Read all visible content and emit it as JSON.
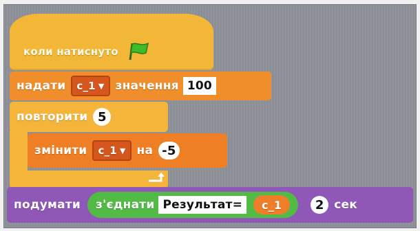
{
  "script": {
    "hat": {
      "label": "коли натиснуто",
      "icon": "green-flag-icon"
    },
    "set_var": {
      "label": "надати",
      "variable": "c_1",
      "middle": "значення",
      "value": "100"
    },
    "repeat": {
      "label": "повторити",
      "count": "5"
    },
    "change_var": {
      "label": "змінити",
      "variable": "c_1",
      "middle": "на",
      "value": "-5"
    },
    "think": {
      "label": "подумати",
      "join_label": "з'єднати",
      "join_text": "Результат=",
      "join_var": "c_1",
      "seconds": "2",
      "unit": "сек"
    }
  },
  "colors": {
    "events": "#f2b736",
    "data": "#f08e2c",
    "control": "#f5b53a",
    "looks": "#8f57b6",
    "operators": "#52bb45",
    "canvas": "#8b8e94"
  }
}
